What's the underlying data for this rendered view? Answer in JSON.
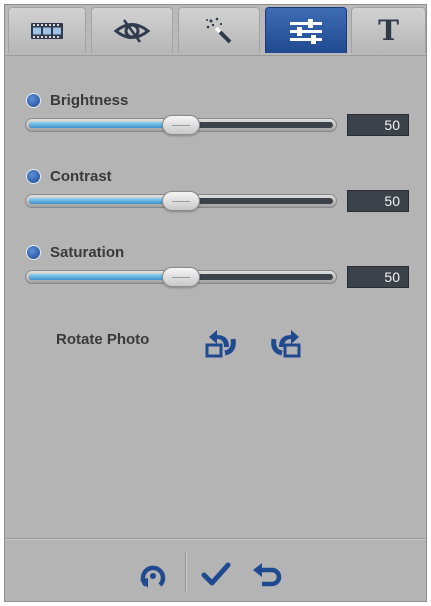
{
  "tabs": [
    {
      "name": "filmstrip",
      "icon": "filmstrip-icon",
      "active": false
    },
    {
      "name": "red-eye",
      "icon": "eye-icon",
      "active": false
    },
    {
      "name": "auto-fix",
      "icon": "magic-wand-icon",
      "active": false
    },
    {
      "name": "adjust",
      "icon": "sliders-icon",
      "active": true
    },
    {
      "name": "text",
      "icon": "text-t-icon",
      "active": false,
      "glyph": "T"
    }
  ],
  "adjustments": {
    "brightness": {
      "label": "Brightness",
      "value": "50",
      "fraction": 0.5
    },
    "contrast": {
      "label": "Contrast",
      "value": "50",
      "fraction": 0.5
    },
    "saturation": {
      "label": "Saturation",
      "value": "50",
      "fraction": 0.5
    }
  },
  "rotate": {
    "label": "Rotate Photo",
    "left_icon": "rotate-left-icon",
    "right_icon": "rotate-right-icon"
  },
  "bottom": {
    "reset_icon": "reset-icon",
    "apply_icon": "checkmark-icon",
    "undo_icon": "undo-icon"
  },
  "colors": {
    "accent": "#1f4a90",
    "panel": "#b4b4b4",
    "value_box": "#3c4249",
    "slider_fill": "#5aaee0"
  }
}
